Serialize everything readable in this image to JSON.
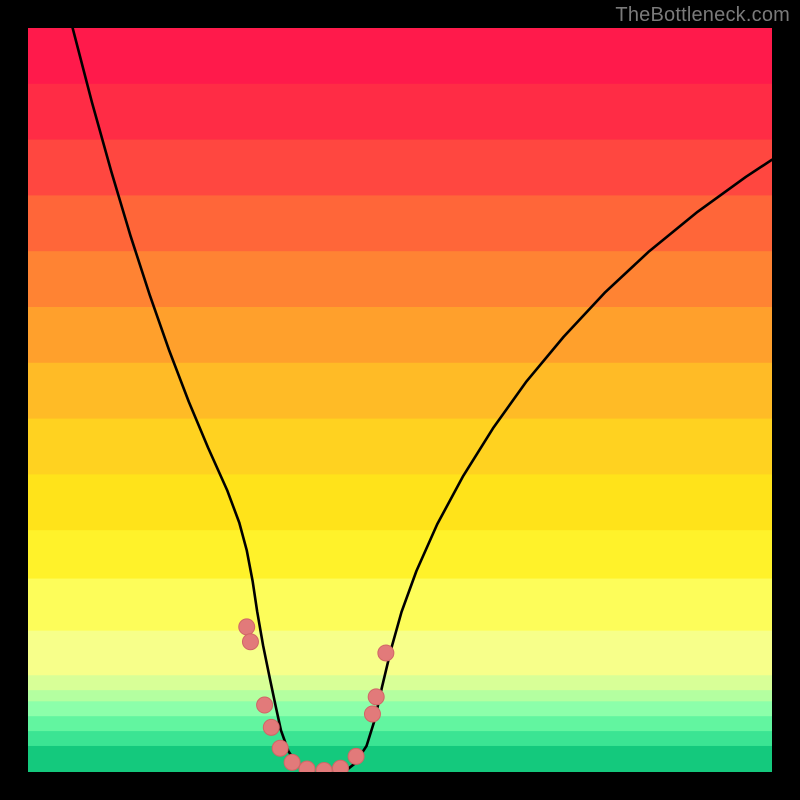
{
  "watermark": "TheBottleneck.com",
  "chart_data": {
    "type": "line",
    "title": "",
    "xlabel": "",
    "ylabel": "",
    "xlim": [
      0,
      1
    ],
    "ylim": [
      0,
      1
    ],
    "gradient_bands": [
      {
        "y0": 0.0,
        "y1": 0.075,
        "color": "#ff1a4b"
      },
      {
        "y0": 0.075,
        "y1": 0.15,
        "color": "#ff2c45"
      },
      {
        "y0": 0.15,
        "y1": 0.225,
        "color": "#ff4740"
      },
      {
        "y0": 0.225,
        "y1": 0.3,
        "color": "#ff6639"
      },
      {
        "y0": 0.3,
        "y1": 0.375,
        "color": "#ff8333"
      },
      {
        "y0": 0.375,
        "y1": 0.45,
        "color": "#ffa02c"
      },
      {
        "y0": 0.45,
        "y1": 0.525,
        "color": "#ffbb26"
      },
      {
        "y0": 0.525,
        "y1": 0.6,
        "color": "#ffd220"
      },
      {
        "y0": 0.6,
        "y1": 0.675,
        "color": "#ffe31a"
      },
      {
        "y0": 0.675,
        "y1": 0.74,
        "color": "#fff22a"
      },
      {
        "y0": 0.74,
        "y1": 0.81,
        "color": "#fdfd5a"
      },
      {
        "y0": 0.81,
        "y1": 0.87,
        "color": "#f7ff8a"
      },
      {
        "y0": 0.87,
        "y1": 0.89,
        "color": "#d8ff97"
      },
      {
        "y0": 0.89,
        "y1": 0.905,
        "color": "#b4ffa0"
      },
      {
        "y0": 0.905,
        "y1": 0.925,
        "color": "#8cffaa"
      },
      {
        "y0": 0.925,
        "y1": 0.945,
        "color": "#62f5a0"
      },
      {
        "y0": 0.945,
        "y1": 0.965,
        "color": "#3be493"
      },
      {
        "y0": 0.965,
        "y1": 1.0,
        "color": "#14c97d"
      }
    ],
    "series": [
      {
        "name": "left-curve",
        "stroke": "#000000",
        "points": [
          {
            "x": 0.06,
            "y": 1.0
          },
          {
            "x": 0.086,
            "y": 0.9
          },
          {
            "x": 0.112,
            "y": 0.807
          },
          {
            "x": 0.138,
            "y": 0.72
          },
          {
            "x": 0.164,
            "y": 0.64
          },
          {
            "x": 0.19,
            "y": 0.566
          },
          {
            "x": 0.216,
            "y": 0.498
          },
          {
            "x": 0.242,
            "y": 0.436
          },
          {
            "x": 0.268,
            "y": 0.378
          },
          {
            "x": 0.284,
            "y": 0.335
          },
          {
            "x": 0.294,
            "y": 0.298
          },
          {
            "x": 0.302,
            "y": 0.256
          },
          {
            "x": 0.308,
            "y": 0.216
          },
          {
            "x": 0.316,
            "y": 0.17
          },
          {
            "x": 0.325,
            "y": 0.126
          },
          {
            "x": 0.333,
            "y": 0.088
          },
          {
            "x": 0.34,
            "y": 0.056
          },
          {
            "x": 0.35,
            "y": 0.028
          },
          {
            "x": 0.362,
            "y": 0.01
          },
          {
            "x": 0.378,
            "y": 0.0
          }
        ]
      },
      {
        "name": "right-curve",
        "stroke": "#000000",
        "points": [
          {
            "x": 0.425,
            "y": 0.0
          },
          {
            "x": 0.44,
            "y": 0.012
          },
          {
            "x": 0.455,
            "y": 0.035
          },
          {
            "x": 0.466,
            "y": 0.07
          },
          {
            "x": 0.476,
            "y": 0.115
          },
          {
            "x": 0.488,
            "y": 0.165
          },
          {
            "x": 0.502,
            "y": 0.215
          },
          {
            "x": 0.522,
            "y": 0.27
          },
          {
            "x": 0.55,
            "y": 0.333
          },
          {
            "x": 0.585,
            "y": 0.398
          },
          {
            "x": 0.625,
            "y": 0.462
          },
          {
            "x": 0.67,
            "y": 0.525
          },
          {
            "x": 0.72,
            "y": 0.585
          },
          {
            "x": 0.775,
            "y": 0.644
          },
          {
            "x": 0.835,
            "y": 0.7
          },
          {
            "x": 0.9,
            "y": 0.753
          },
          {
            "x": 0.965,
            "y": 0.8
          },
          {
            "x": 1.0,
            "y": 0.823
          }
        ]
      }
    ],
    "markers": {
      "fill": "#e27a7a",
      "stroke": "#d06666",
      "radius_px": 8,
      "points": [
        {
          "x": 0.294,
          "y": 0.195
        },
        {
          "x": 0.299,
          "y": 0.175
        },
        {
          "x": 0.318,
          "y": 0.09
        },
        {
          "x": 0.327,
          "y": 0.06
        },
        {
          "x": 0.339,
          "y": 0.032
        },
        {
          "x": 0.355,
          "y": 0.013
        },
        {
          "x": 0.375,
          "y": 0.004
        },
        {
          "x": 0.398,
          "y": 0.002
        },
        {
          "x": 0.42,
          "y": 0.005
        },
        {
          "x": 0.441,
          "y": 0.021
        },
        {
          "x": 0.463,
          "y": 0.078
        },
        {
          "x": 0.468,
          "y": 0.101
        },
        {
          "x": 0.481,
          "y": 0.16
        }
      ]
    }
  }
}
